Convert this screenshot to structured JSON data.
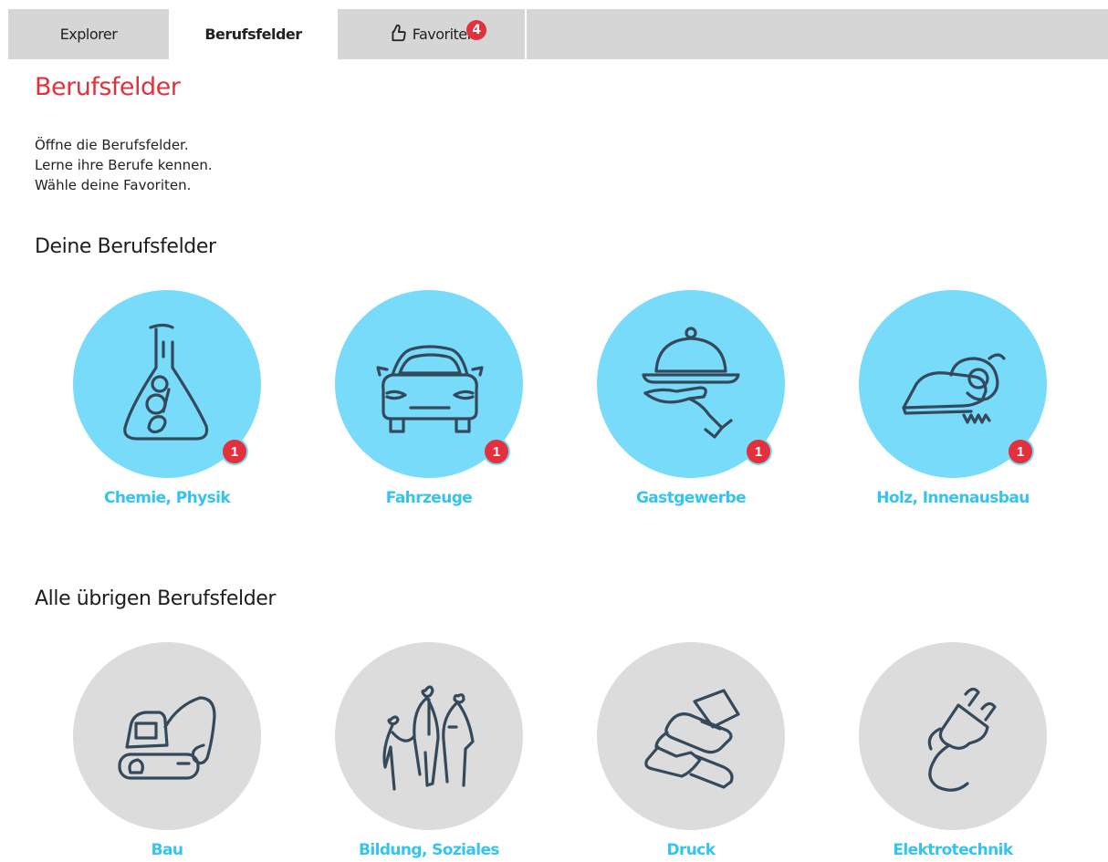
{
  "tabs": [
    {
      "label": "Explorer",
      "active": false
    },
    {
      "label": "Berufsfelder",
      "active": true
    },
    {
      "label": "Favoriten",
      "active": false,
      "badge": "4",
      "icon": "thumbs-up-icon"
    }
  ],
  "page": {
    "title": "Berufsfelder",
    "intro": [
      "Öffne die Berufsfelder.",
      "Lerne ihre Berufe kennen.",
      "Wähle deine Favoriten."
    ]
  },
  "sections": {
    "mine": {
      "heading": "Deine Berufsfelder",
      "items": [
        {
          "label": "Chemie, Physik",
          "count": "1",
          "icon": "flask-icon"
        },
        {
          "label": "Fahrzeuge",
          "count": "1",
          "icon": "car-icon"
        },
        {
          "label": "Gastgewerbe",
          "count": "1",
          "icon": "cloche-icon"
        },
        {
          "label": "Holz, Innenausbau",
          "count": "1",
          "icon": "circular-saw-icon"
        }
      ]
    },
    "others": {
      "heading": "Alle übrigen Berufsfelder",
      "items": [
        {
          "label": "Bau",
          "icon": "excavator-icon"
        },
        {
          "label": "Bildung, Soziales",
          "icon": "people-icon"
        },
        {
          "label": "Druck",
          "icon": "printer-icon"
        },
        {
          "label": "Elektrotechnik",
          "icon": "plug-icon"
        }
      ]
    }
  },
  "colors": {
    "accent_red": "#e2313d",
    "label_blue": "#35c3f0",
    "circle_blue": "#79dbfa",
    "circle_grey": "#dcdcdc",
    "line_art": "#34495b"
  }
}
